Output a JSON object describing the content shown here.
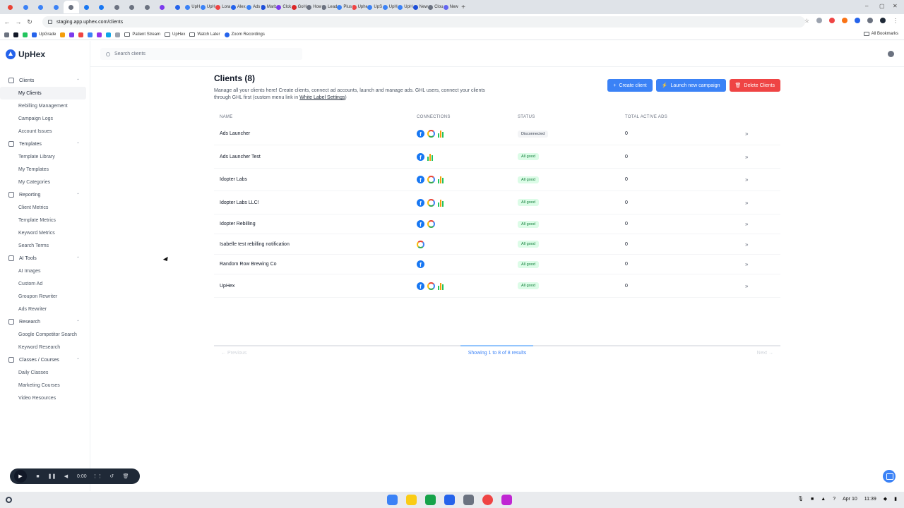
{
  "browser": {
    "url": "staging.app.uphex.com/clients",
    "tabs": [
      {
        "label": "",
        "color": "#ea4335"
      },
      {
        "label": "",
        "color": "#3b82f6"
      },
      {
        "label": "",
        "color": "#3b82f6"
      },
      {
        "label": "",
        "color": "#3b82f6"
      },
      {
        "label": "",
        "color": "#6b7280",
        "active": true
      },
      {
        "label": "",
        "color": "#1877f2"
      },
      {
        "label": "",
        "color": "#1877f2"
      },
      {
        "label": "",
        "color": "#6b7280"
      },
      {
        "label": "",
        "color": "#6b7280"
      },
      {
        "label": "",
        "color": "#6b7280"
      },
      {
        "label": "",
        "color": "#7c3aed"
      },
      {
        "label": "",
        "color": "#2563eb"
      },
      {
        "label": "UpH",
        "color": "#3b82f6"
      },
      {
        "label": "UpH",
        "color": "#3b82f6"
      },
      {
        "label": "Lora",
        "color": "#ef4444"
      },
      {
        "label": "Alex",
        "color": "#2563eb"
      },
      {
        "label": "Ads",
        "color": "#3b82f6"
      },
      {
        "label": "Marb",
        "color": "#1d4ed8"
      },
      {
        "label": "Clck",
        "color": "#7c3aed"
      },
      {
        "label": "GoH",
        "color": "#dc2626"
      },
      {
        "label": "How",
        "color": "#6b7280"
      },
      {
        "label": "Lead",
        "color": "#6b7280"
      },
      {
        "label": "Plus",
        "color": "#3b82f6"
      },
      {
        "label": "Uphe",
        "color": "#ef4444"
      },
      {
        "label": "UpS",
        "color": "#3b82f6"
      },
      {
        "label": "UpH",
        "color": "#3b82f6"
      },
      {
        "label": "UpH",
        "color": "#3b82f6"
      },
      {
        "label": "New",
        "color": "#1d4ed8"
      },
      {
        "label": "Clou",
        "color": "#6b7280"
      },
      {
        "label": "New",
        "color": "#6366f1"
      }
    ],
    "bookmarks": [
      "UpGrade",
      "Patient Stream",
      "UpHex",
      "Watch Later",
      "Zoom Recordings"
    ],
    "all_bookmarks": "All Bookmarks"
  },
  "app": {
    "logo": "UpHex",
    "search_placeholder": "Search clients"
  },
  "sidebar": {
    "sections": [
      {
        "label": "Clients",
        "icon": "megaphone-icon",
        "items": [
          "My Clients",
          "Rebilling Management",
          "Campaign Logs",
          "Account Issues"
        ]
      },
      {
        "label": "Templates",
        "icon": "document-icon",
        "items": [
          "Template Library",
          "My Templates",
          "My Categories"
        ]
      },
      {
        "label": "Reporting",
        "icon": "chart-icon",
        "items": [
          "Client Metrics",
          "Template Metrics",
          "Keyword Metrics",
          "Search Terms"
        ]
      },
      {
        "label": "AI Tools",
        "icon": "sparkle-icon",
        "items": [
          "AI Images",
          "Custom Ad",
          "Groupon Rewriter",
          "Ads Rewriter"
        ]
      },
      {
        "label": "Research",
        "icon": "search-icon",
        "items": [
          "Google Competitor Search",
          "Keyword Research"
        ]
      },
      {
        "label": "Classes / Courses",
        "icon": "book-icon",
        "items": [
          "Daily Classes",
          "Marketing Courses",
          "Video Resources"
        ]
      }
    ],
    "active_item": "My Clients"
  },
  "page": {
    "title": "Clients (8)",
    "description": "Manage all your clients here! Create clients, connect ad accounts, launch and manage ads. GHL users, connect your clients through GHL first (custom menu link in",
    "description_link": "White Label Settings",
    "description_end": ")",
    "buttons": {
      "create": "Create client",
      "launch": "Launch new campaign",
      "delete": "Delete Clients"
    }
  },
  "table": {
    "headers": [
      "NAME",
      "CONNECTIONS",
      "STATUS",
      "TOTAL ACTIVE ADS"
    ],
    "rows": [
      {
        "name": "Ads Launcher",
        "connections": [
          "facebook",
          "google",
          "analytics"
        ],
        "status": "Disconnected",
        "ads": "0"
      },
      {
        "name": "Ads Launcher Test",
        "connections": [
          "facebook",
          "analytics"
        ],
        "status": "All good",
        "ads": "0"
      },
      {
        "name": "Idopter Labs",
        "connections": [
          "facebook",
          "google",
          "analytics"
        ],
        "status": "All good",
        "ads": "0"
      },
      {
        "name": "Idopter Labs LLC!",
        "connections": [
          "facebook",
          "google",
          "analytics"
        ],
        "status": "All good",
        "ads": "0"
      },
      {
        "name": "Idopter Rebilling",
        "connections": [
          "facebook",
          "google"
        ],
        "status": "All good",
        "ads": "0"
      },
      {
        "name": "Isabelle test rebilling notification",
        "connections": [
          "google"
        ],
        "status": "All good",
        "ads": "0"
      },
      {
        "name": "Random Row Brewing Co",
        "connections": [
          "facebook"
        ],
        "status": "All good",
        "ads": "0"
      },
      {
        "name": "UpHex",
        "connections": [
          "facebook",
          "google",
          "analytics"
        ],
        "status": "All good",
        "ads": "0"
      }
    ]
  },
  "pagination": {
    "previous": "Previous",
    "next": "Next",
    "info": "Showing 1 to 8 of 8 results"
  },
  "recorder": {
    "time": "0:00"
  },
  "system": {
    "date": "Apr 10",
    "time": "11:39"
  }
}
